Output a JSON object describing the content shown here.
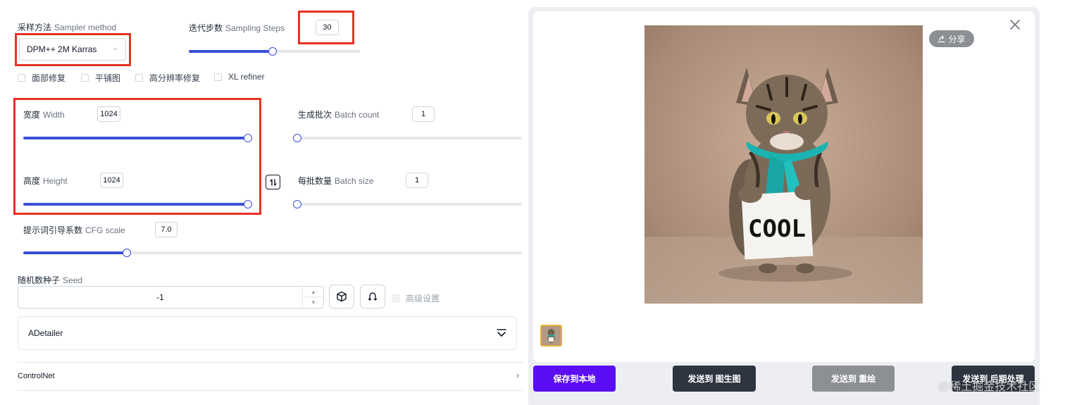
{
  "sampler": {
    "label_cn": "采样方法",
    "label_en": "Sampler method",
    "value": "DPM++ 2M Karras"
  },
  "steps": {
    "label_cn": "迭代步数",
    "label_en": "Sampling Steps",
    "value": "30",
    "fraction": 0.49
  },
  "checkboxes": [
    {
      "label": "面部修复",
      "checked": false
    },
    {
      "label": "平铺图",
      "checked": false
    },
    {
      "label": "高分辨率修复",
      "checked": false
    },
    {
      "label": "XL refiner",
      "checked": false
    }
  ],
  "width": {
    "label_cn": "宽度",
    "label_en": "Width",
    "value": "1024",
    "fraction": 1.0
  },
  "height": {
    "label_cn": "高度",
    "label_en": "Height",
    "value": "1024",
    "fraction": 1.0
  },
  "batch_count": {
    "label_cn": "生成批次",
    "label_en": "Batch count",
    "value": "1",
    "fraction": 0.0
  },
  "batch_size": {
    "label_cn": "每批数量",
    "label_en": "Batch size",
    "value": "1",
    "fraction": 0.0
  },
  "cfg": {
    "label_cn": "提示词引导系数",
    "label_en": "CFG scale",
    "value": "7.0",
    "fraction": 0.207
  },
  "seed": {
    "label_cn": "随机数种子",
    "label_en": "Seed",
    "value": "-1",
    "advanced_label": "高级设置"
  },
  "adetailer": {
    "label": "ADetailer"
  },
  "controlnet": {
    "label": "ControlNet"
  },
  "preview": {
    "share_label": "分享",
    "sign_text": "COOL"
  },
  "actions": {
    "save_local": "保存到本地",
    "send_img2img": "发送到 图生图",
    "send_inpaint": "发送到 重绘",
    "send_extras": "发送到 后期处理"
  },
  "watermark": "@稀土掘金技术社区",
  "colors": {
    "accent": "#3b4fd9",
    "highlight": "#e53224",
    "primary_button": "#5b0ef3",
    "dark_button": "#2f3540",
    "gray_button": "#8c8f94"
  }
}
